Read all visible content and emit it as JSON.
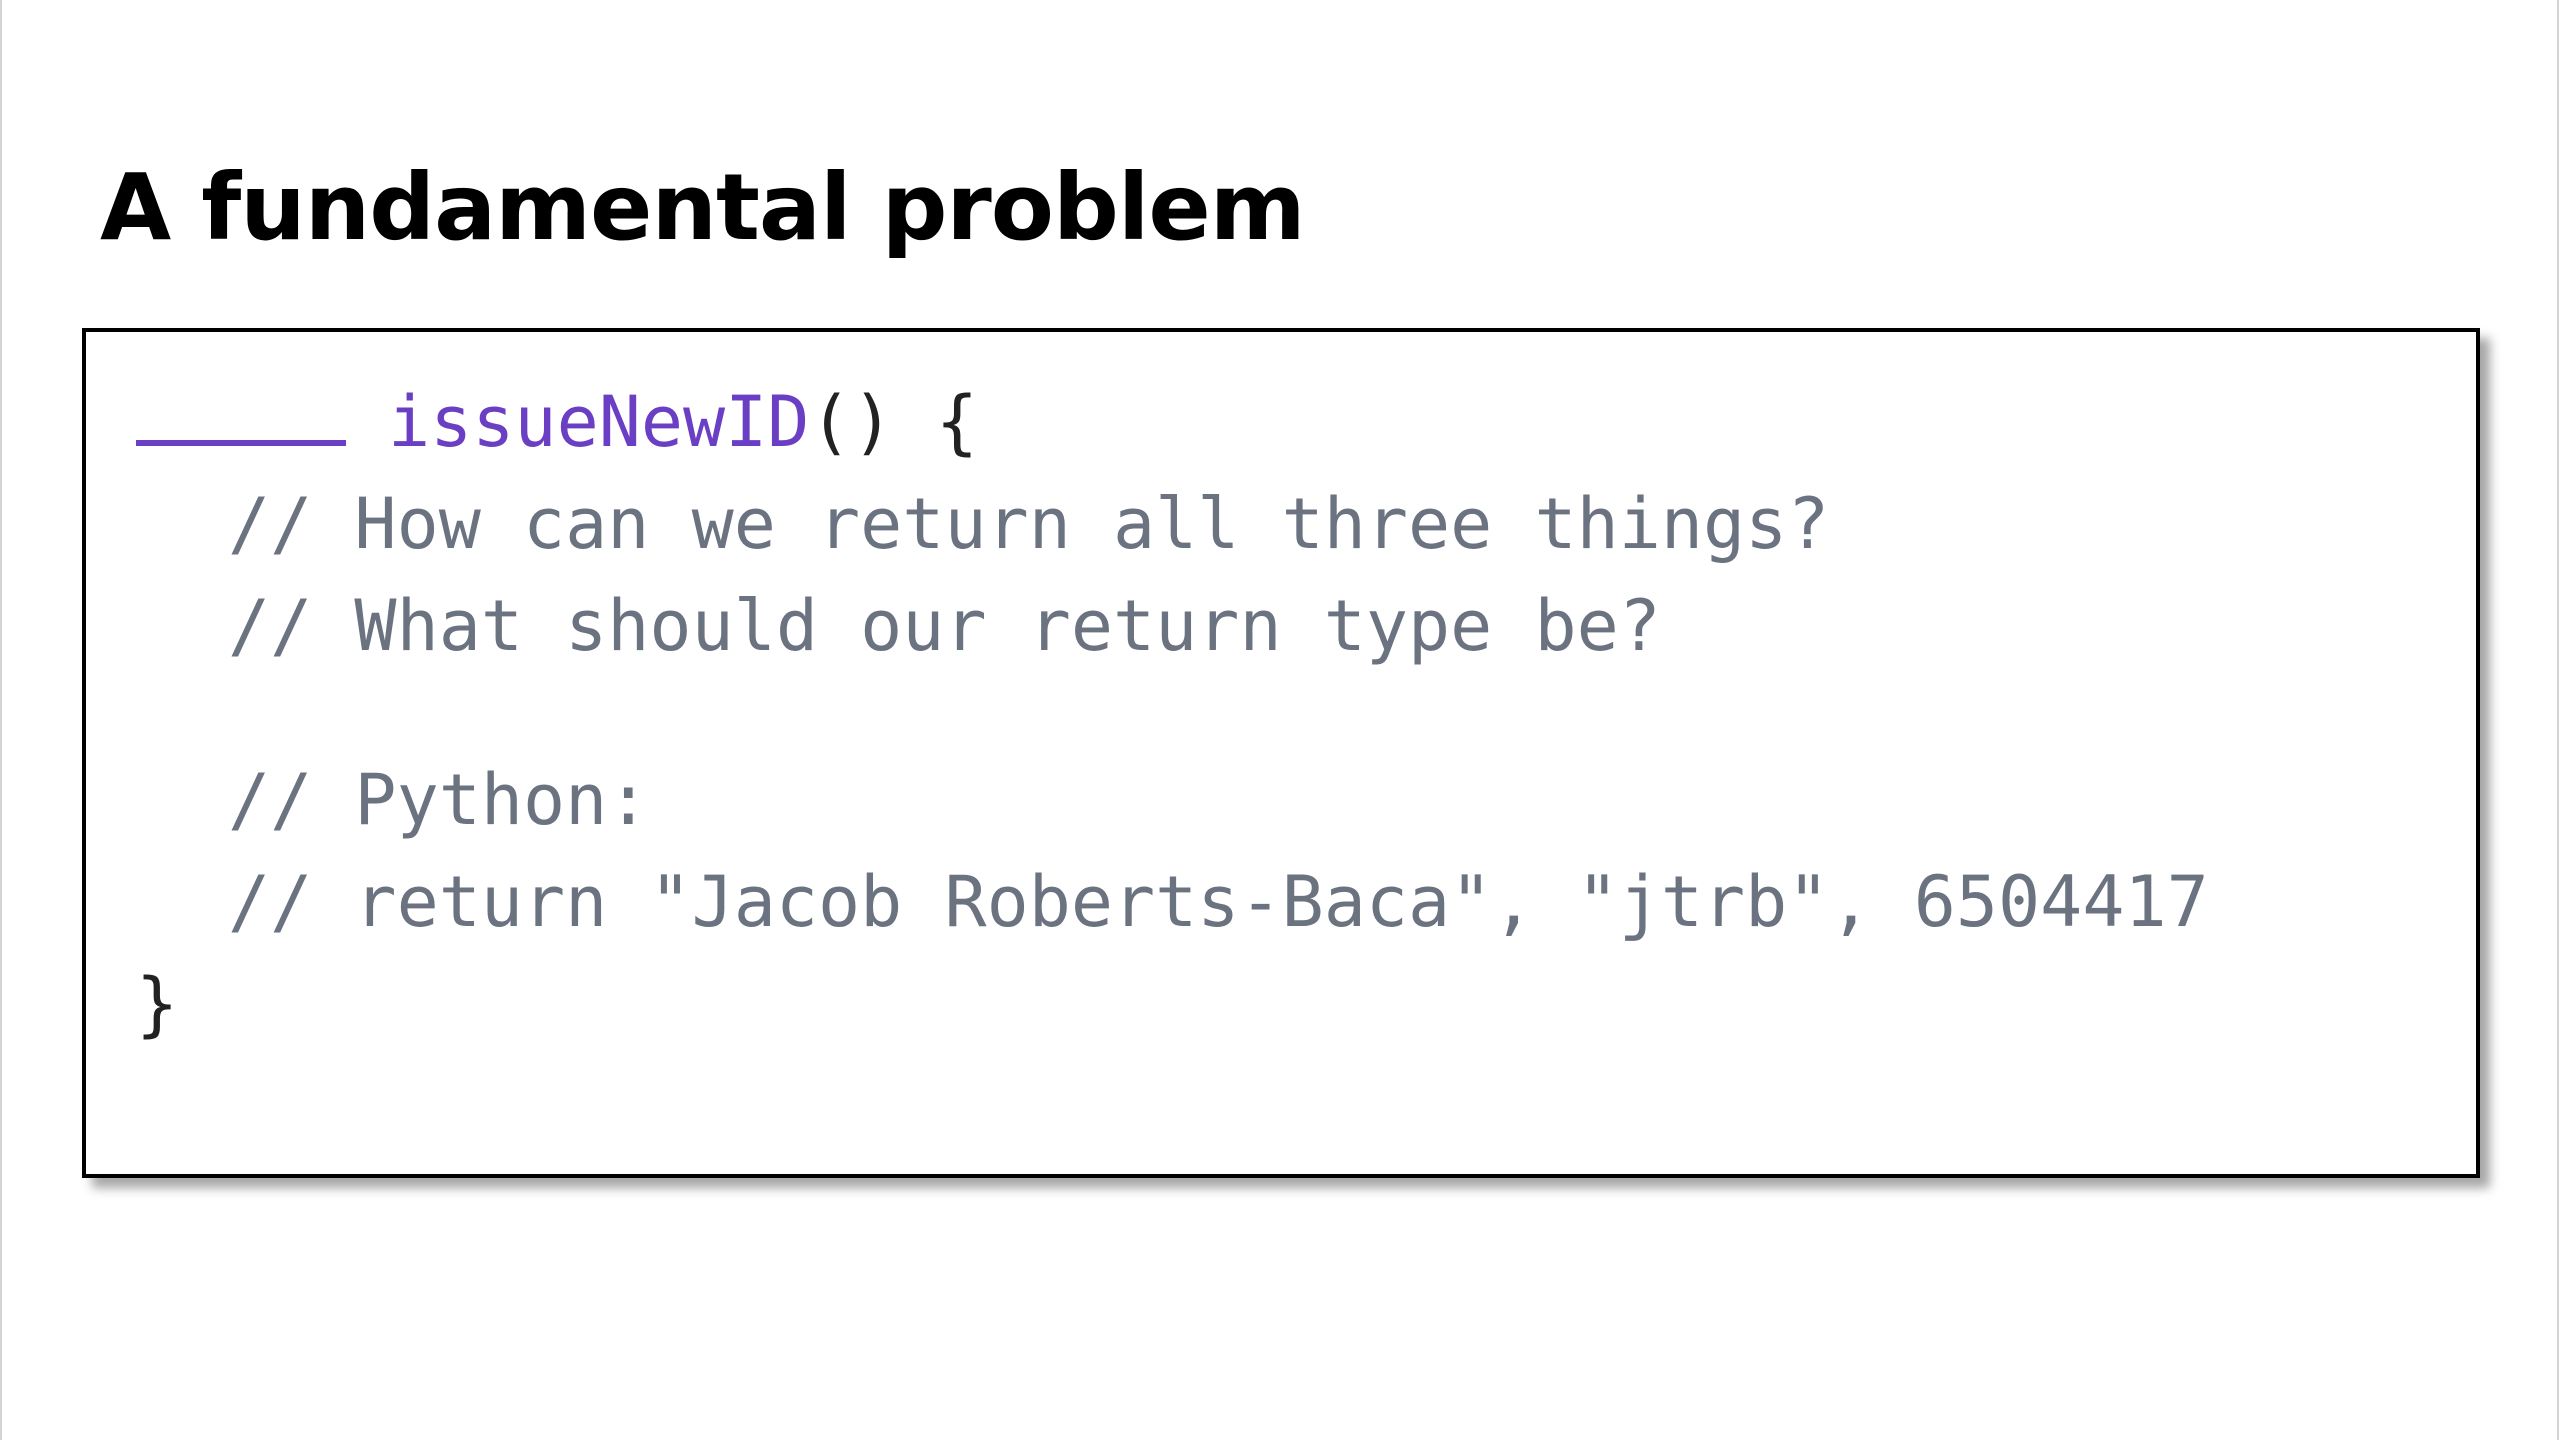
{
  "slide": {
    "title": "A fundamental problem"
  },
  "code": {
    "function_name": "issueNewID",
    "signature_rest": "() {",
    "comments": [
      "// How can we return all three things?",
      "// What should our return type be?",
      "// Python:",
      "// return \"Jacob Roberts-Baca\", \"jtrb\", 6504417"
    ],
    "closing_brace": "}"
  },
  "colors": {
    "function_name": "#6b3fc3",
    "comment": "#6b7280",
    "text": "#222222",
    "border": "#000000"
  }
}
